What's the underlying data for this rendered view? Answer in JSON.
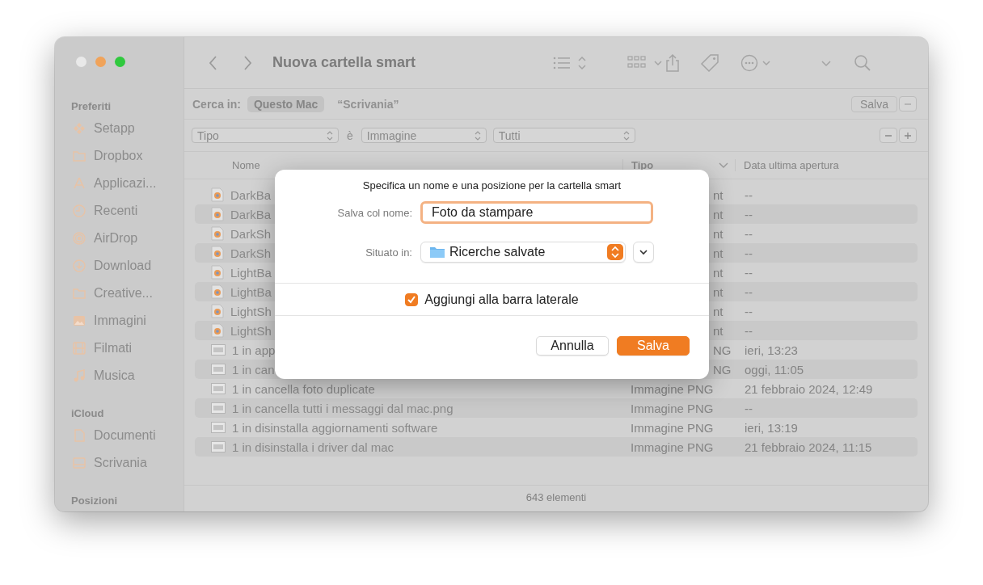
{
  "window": {
    "title": "Nuova cartella smart"
  },
  "sidebar": {
    "sections": [
      {
        "title": "Preferiti",
        "items": [
          {
            "label": "Setapp"
          },
          {
            "label": "Dropbox"
          },
          {
            "label": "Applicazi..."
          },
          {
            "label": "Recenti"
          },
          {
            "label": "AirDrop"
          },
          {
            "label": "Download"
          },
          {
            "label": "Creative..."
          },
          {
            "label": "Immagini"
          },
          {
            "label": "Filmati"
          },
          {
            "label": "Musica"
          }
        ]
      },
      {
        "title": "iCloud",
        "items": [
          {
            "label": "Documenti"
          },
          {
            "label": "Scrivania"
          }
        ]
      },
      {
        "title": "Posizioni"
      }
    ]
  },
  "search_scope": {
    "label": "Cerca in:",
    "tabs": [
      {
        "label": "Questo Mac",
        "selected": true
      },
      {
        "label": "“Scrivania”",
        "selected": false
      }
    ],
    "save_button": "Salva"
  },
  "criteria": {
    "attribute": "Tipo",
    "operator": "è",
    "value": "Immagine",
    "subvalue": "Tutti"
  },
  "table": {
    "columns": [
      "Nome",
      "Tipo",
      "Data ultima apertura"
    ],
    "rows": [
      {
        "kind": "document",
        "name": "DarkBa",
        "type": "nt",
        "date": "--",
        "covered": true
      },
      {
        "kind": "document",
        "name": "DarkBa",
        "type": "nt",
        "date": "--",
        "covered": true
      },
      {
        "kind": "document",
        "name": "DarkSh",
        "type": "nt",
        "date": "--",
        "covered": true
      },
      {
        "kind": "document",
        "name": "DarkSh",
        "type": "nt",
        "date": "--",
        "covered": true
      },
      {
        "kind": "document",
        "name": "LightBa",
        "type": "nt",
        "date": "--",
        "covered": true
      },
      {
        "kind": "document",
        "name": "LightBa",
        "type": "nt",
        "date": "--",
        "covered": true
      },
      {
        "kind": "document",
        "name": "LightSh",
        "type": "nt",
        "date": "--",
        "covered": true
      },
      {
        "kind": "document",
        "name": "LightSh",
        "type": "nt",
        "date": "--",
        "covered": true
      },
      {
        "kind": "image",
        "name": "1 in app",
        "type": "NG",
        "date": "ieri, 13:23",
        "covered": true
      },
      {
        "kind": "image",
        "name": "1 in can",
        "type": "NG",
        "date": "oggi, 11:05",
        "covered": true
      },
      {
        "kind": "image",
        "name": "1 in cancella foto duplicate",
        "type": "Immagine PNG",
        "date": "21 febbraio 2024, 12:49",
        "covered": false
      },
      {
        "kind": "image",
        "name": "1 in cancella tutti i messaggi dal mac.png",
        "type": "Immagine PNG",
        "date": "--",
        "covered": false
      },
      {
        "kind": "image",
        "name": "1 in disinstalla aggiornamenti software",
        "type": "Immagine PNG",
        "date": "ieri, 13:19",
        "covered": false
      },
      {
        "kind": "image",
        "name": "1 in disinstalla i driver dal mac",
        "type": "Immagine PNG",
        "date": "21 febbraio 2024, 11:15",
        "covered": false
      }
    ]
  },
  "status_bar": "643 elementi",
  "dialog": {
    "title": "Specifica un nome e una posizione per la cartella smart",
    "name_label": "Salva col nome:",
    "name_value": "Foto da stampare",
    "location_label": "Situato in:",
    "location_value": "Ricerche salvate",
    "add_to_sidebar": {
      "label": "Aggiungi alla barra laterale",
      "checked": true
    },
    "buttons": [
      {
        "label": "Annulla",
        "default": false
      },
      {
        "label": "Salva",
        "default": true
      }
    ]
  }
}
